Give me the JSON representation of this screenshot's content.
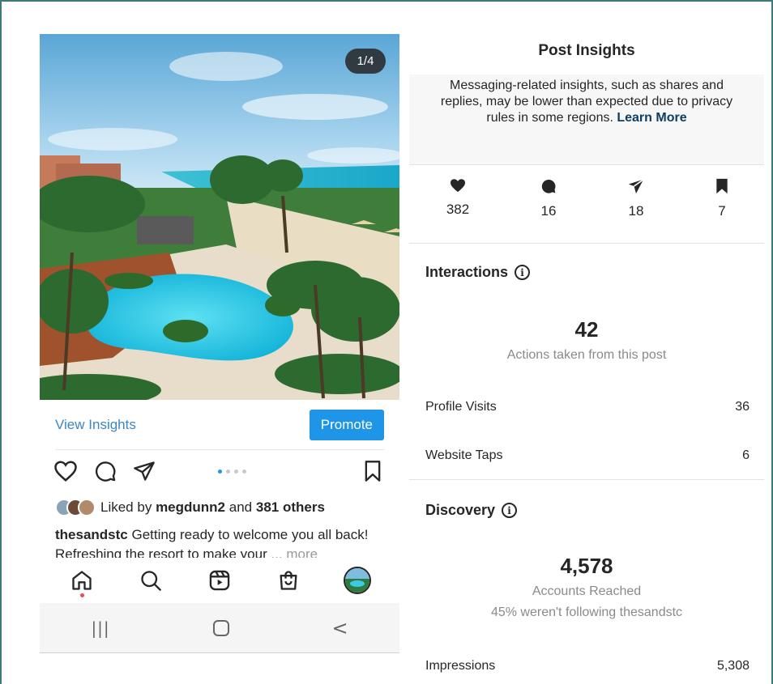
{
  "post": {
    "image_counter": "1/4",
    "view_insights_label": "View Insights",
    "promote_label": "Promote",
    "liked_prefix": "Liked by",
    "liked_user": "megdunn2",
    "liked_and": "and",
    "liked_others": "381 others",
    "caption_user": "thesandstc",
    "caption_text": "Getting ready to welcome you all back! Refreshing the resort to make your",
    "caption_more": "... more",
    "carousel": {
      "total": 4,
      "active": 1
    }
  },
  "bottom_nav": {
    "items": [
      "home-icon",
      "search-icon",
      "reels-icon",
      "shop-icon",
      "profile-avatar"
    ]
  },
  "system_nav": {
    "items": [
      "recent-apps-icon",
      "home-button-icon",
      "back-icon"
    ],
    "glyphs": [
      "|||",
      "▢",
      "<"
    ]
  },
  "insights": {
    "title": "Post Insights",
    "notice_text": "Messaging-related insights, such as shares and replies, may be lower than expected due to privacy rules in some regions.",
    "notice_link": "Learn More",
    "stats": [
      {
        "icon": "heart-icon",
        "value": "382"
      },
      {
        "icon": "comment-icon",
        "value": "16"
      },
      {
        "icon": "share-icon",
        "value": "18"
      },
      {
        "icon": "bookmark-icon",
        "value": "7"
      }
    ],
    "interactions": {
      "title": "Interactions",
      "total": "42",
      "total_label": "Actions taken from this post",
      "rows": [
        {
          "label": "Profile Visits",
          "value": "36"
        },
        {
          "label": "Website Taps",
          "value": "6"
        }
      ]
    },
    "discovery": {
      "title": "Discovery",
      "total": "4,578",
      "total_label": "Accounts Reached",
      "note": "45% weren't following thesandstc",
      "rows": [
        {
          "label": "Impressions",
          "value": "5,308"
        }
      ]
    }
  },
  "colors": {
    "accent_blue": "#1e95e6",
    "link_blue": "#3b87c4",
    "notification_red": "#ed4956",
    "frame_border": "#3d7a7a"
  }
}
